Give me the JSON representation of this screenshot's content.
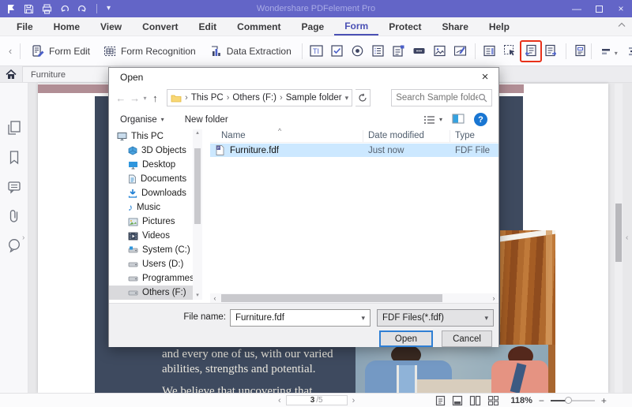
{
  "app": {
    "title": "Wondershare PDFelement Pro"
  },
  "colors": {
    "titlebar": "#6365c7",
    "accent_blue": "#4a50b5",
    "selection_blue": "#cce8ff",
    "red_highlight": "#e8311a",
    "page_pink": "#b18e95",
    "page_navy": "#3e4a5f",
    "help_blue": "#1976d2"
  },
  "glyphs": {
    "back_arrow": "←",
    "forward_arrow": "→",
    "up_arrow": "↑",
    "caret_down": "▾",
    "caret_up": "▴",
    "chevron_left": "‹",
    "chevron_right": "›",
    "close": "×",
    "minimize": "—",
    "music_note": "♪",
    "question_mark": "?",
    "sort_indicator": "^",
    "minus": "−",
    "plus": "+",
    "text_field_glyph": "TI",
    "file_badge": "F"
  },
  "menubar": {
    "items": [
      "File",
      "Home",
      "View",
      "Convert",
      "Edit",
      "Comment",
      "Page",
      "Form",
      "Protect",
      "Share",
      "Help"
    ],
    "active": "Form"
  },
  "toolbar": {
    "form_edit": "Form Edit",
    "form_recognition": "Form Recognition",
    "data_extraction": "Data Extraction"
  },
  "tabs": {
    "active": "Furniture"
  },
  "dialog": {
    "title": "Open",
    "nav": {
      "crumb_root": "This PC",
      "crumb_drive": "Others (F:)",
      "crumb_folder": "Sample folder",
      "search_placeholder": "Search Sample folder"
    },
    "commands": {
      "organise": "Organise",
      "new_folder": "New folder"
    },
    "columns": {
      "name": "Name",
      "date": "Date modified",
      "type": "Type"
    },
    "file": {
      "name": "Furniture.fdf",
      "date": "Just now",
      "type": "FDF File"
    },
    "tree": {
      "items": [
        "This PC",
        "3D Objects",
        "Desktop",
        "Documents",
        "Downloads",
        "Music",
        "Pictures",
        "Videos",
        "System (C:)",
        "Users (D:)",
        "Programmes (E:)",
        "Others (F:)"
      ]
    },
    "footer": {
      "file_name_label": "File name:",
      "file_name_value": "Furniture.fdf",
      "file_type": "FDF Files(*.fdf)",
      "open": "Open",
      "cancel": "Cancel"
    }
  },
  "document": {
    "line1": "and every one of us, with our varied",
    "line2": "abilities, strengths and potential.",
    "line3": "We believe that uncovering that"
  },
  "statusbar": {
    "page": "3",
    "page_total": "/5",
    "zoom": "118%"
  }
}
